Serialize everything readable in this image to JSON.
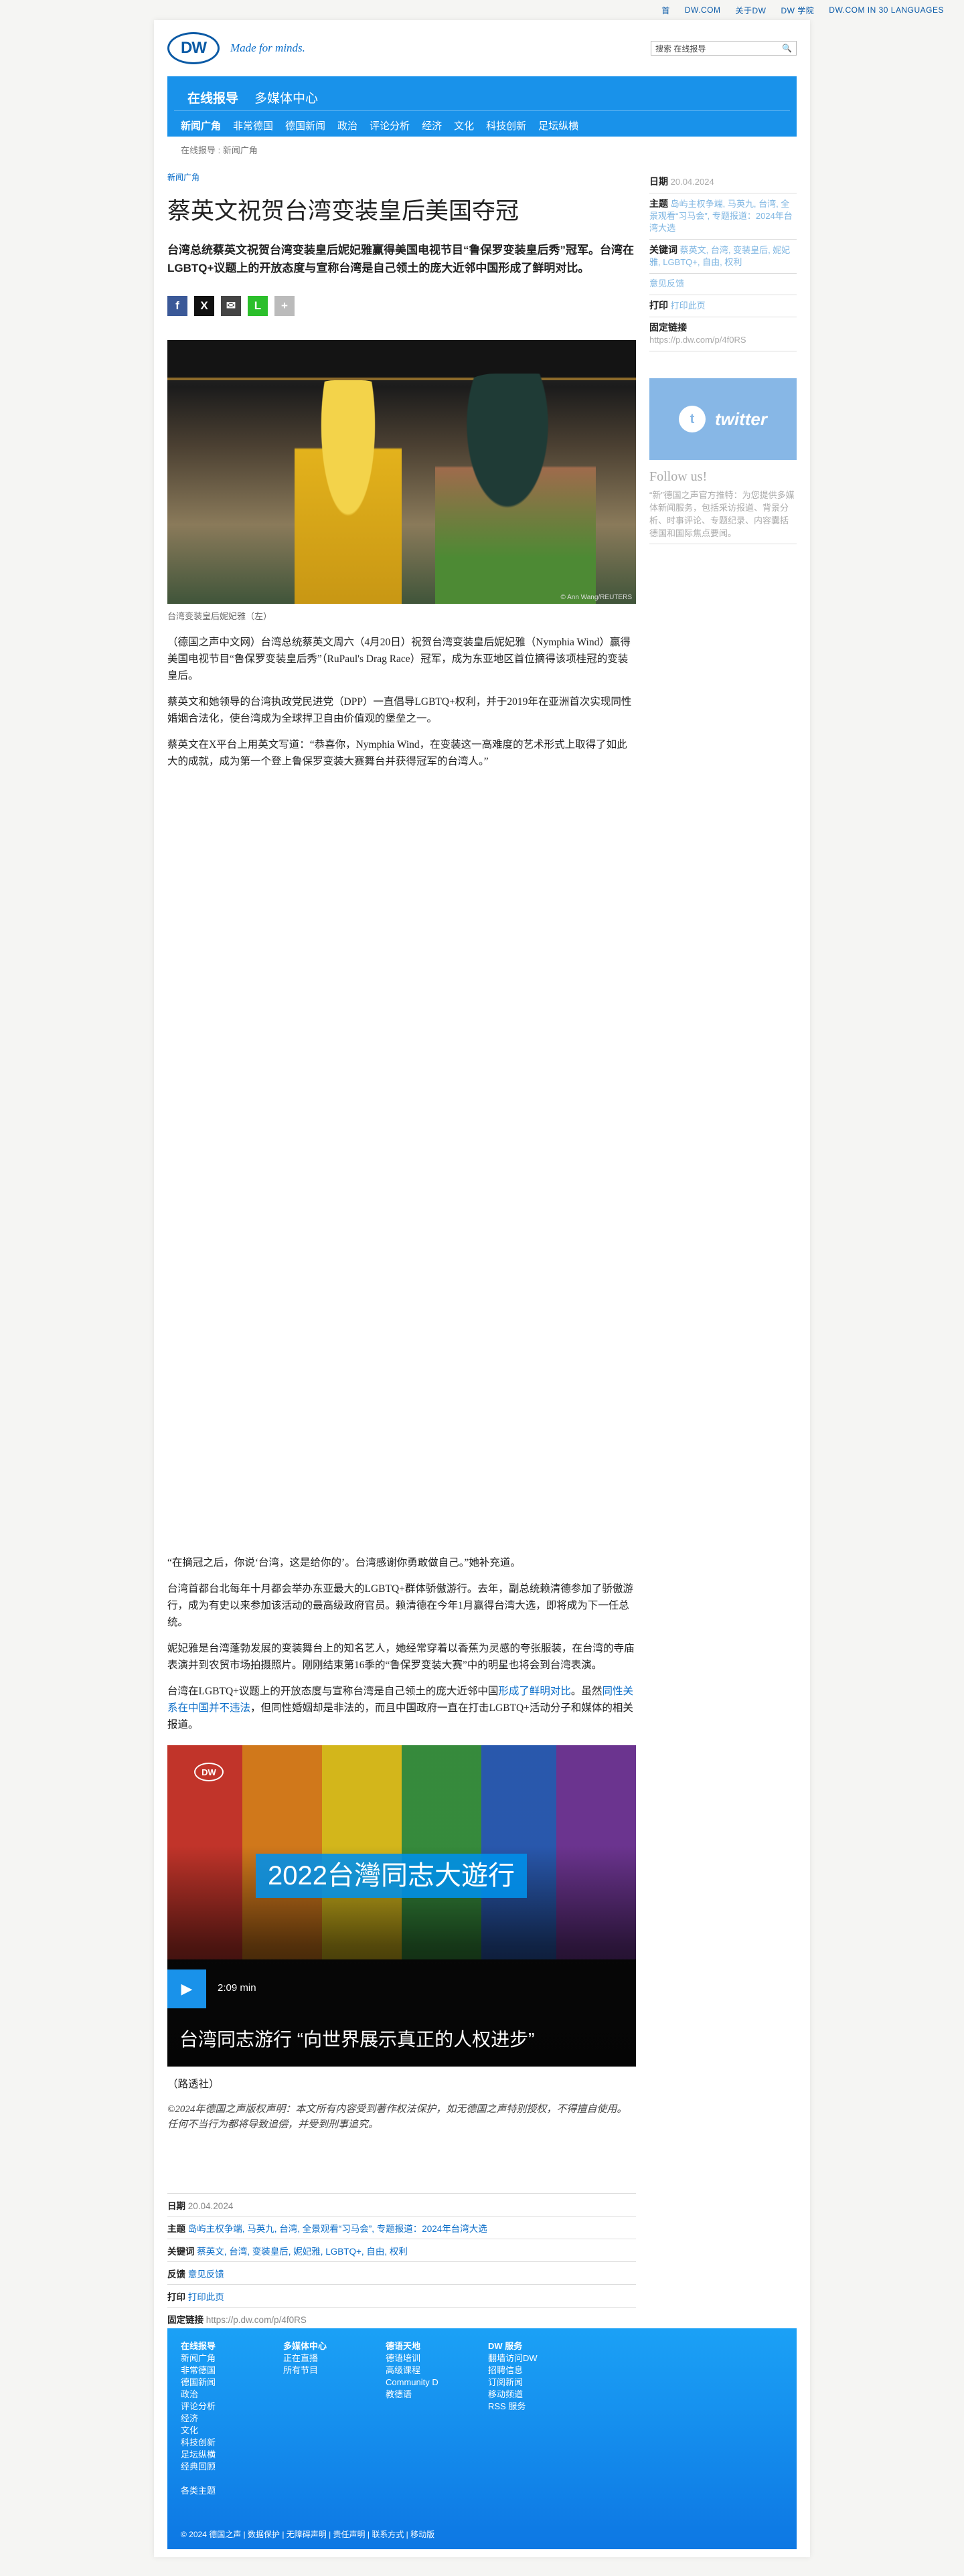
{
  "topbar": {
    "links": [
      "首",
      "DW.COM",
      "关于DW",
      "DW 学院",
      "DW.COM IN 30 LANGUAGES"
    ]
  },
  "header": {
    "logo": "DW",
    "tagline": "Made for minds.",
    "search_placeholder": "搜索 在线报导",
    "search_icon": "magnifier-icon"
  },
  "nav": {
    "top": [
      "在线报导",
      "多媒体中心"
    ],
    "sub": [
      "新闻广角",
      "非常德国",
      "德国新闻",
      "政治",
      "评论分析",
      "经济",
      "文化",
      "科技创新",
      "足坛纵横"
    ]
  },
  "breadcrumb": "在线报导 : 新闻广角",
  "article": {
    "kicker": "新闻广角",
    "title": "蔡英文祝贺台湾变装皇后美国夺冠",
    "lead": "台湾总统蔡英文祝贺台湾变装皇后妮妃雅赢得美国电视节目“鲁保罗变装皇后秀”冠军。台湾在LGBTQ+议题上的开放态度与宣称台湾是自己领土的庞大近邻中国形成了鲜明对比。",
    "share": [
      "f",
      "X",
      "✉",
      "L",
      "+"
    ],
    "image_credit": "© Ann Wang/REUTERS",
    "caption": "台湾变装皇后妮妃雅（左）",
    "paragraphs": [
      "（德国之声中文网）台湾总统蔡英文周六（4月20日）祝贺台湾变装皇后妮妃雅（Nymphia Wind）赢得美国电视节目“鲁保罗变装皇后秀”（RuPaul's Drag Race）冠军，成为东亚地区首位摘得该项桂冠的变装皇后。",
      "蔡英文和她领导的台湾执政党民进党（DPP）一直倡导LGBTQ+权利，并于2019年在亚洲首次实现同性婚姻合法化，使台湾成为全球捍卫自由价值观的堡垒之一。",
      "蔡英文在X平台上用英文写道：“恭喜你，Nymphia Wind，在变装这一高难度的艺术形式上取得了如此大的成就，成为第一个登上鲁保罗变装大赛舞台并获得冠军的台湾人。”",
      "“在摘冠之后，你说‘台湾，这是给你的’。台湾感谢你勇敢做自己。”她补充道。",
      "台湾首都台北每年十月都会举办东亚最大的LGBTQ+群体骄傲游行。去年，副总统赖清德参加了骄傲游行，成为有史以来参加该活动的最高级政府官员。赖清德在今年1月赢得台湾大选，即将成为下一任总统。",
      "妮妃雅是台湾蓬勃发展的变装舞台上的知名艺人，她经常穿着以香蕉为灵感的夸张服装，在台湾的寺庙表演并到农贸市场拍摄照片。刚刚结束第16季的“鲁保罗变装大赛”中的明星也将会到台湾表演。"
    ],
    "p7_before": "台湾在LGBTQ+议题上的开放态度与宣称台湾是自己领土的庞大近邻中国",
    "p7_link1": "形成了鲜明对比",
    "p7_mid": "。虽然",
    "p7_link2": "同性关系在中国并不违法",
    "p7_after": "，但同性婚姻却是非法的，而且中国政府一直在打击LGBTQ+活动分子和媒体的相关报道。",
    "video": {
      "overlay_title": "2022台灣同志大遊行",
      "duration": "2:09 min",
      "title": "台湾同志游行 “向世界展示真正的人权进步”",
      "play_icon": "play-icon"
    },
    "byline": "（路透社）",
    "copyright": "©2024年德国之声版权声明：本文所有内容受到著作权法保护，如无德国之声特别授权，不得擅自使用。任何不当行为都将导致追偿，并受到刑事追究。"
  },
  "meta": {
    "date_label": "日期",
    "date": "20.04.2024",
    "topic_label": "主题",
    "topic": "岛屿主权争端, 马英九, 台湾, 全景观看“习马会”, 专题报道：2024年台湾大选",
    "keywords_label": "关键词",
    "keywords": "蔡英文, 台湾, 变装皇后, 妮妃雅, LGBTQ+, 自由, 权利",
    "feedback_label": "反馈",
    "feedback": "意见反馈",
    "print_label": "打印",
    "print": "打印此页",
    "permalink_label": "固定链接",
    "permalink": "https://p.dw.com/p/4f0RS"
  },
  "sidebar": {
    "twitter_label": "twitter",
    "follow": "Follow us!",
    "follow_text": "“新”德国之声官方推特：为您提供多媒体新闻服务，包括采访报道、背景分析、时事评论、专题纪录、内容囊括德国和国际焦点要闻。"
  },
  "footer": {
    "cols": [
      {
        "head": "在线报导",
        "items": [
          "新闻广角",
          "非常德国",
          "德国新闻",
          "政治",
          "评论分析",
          "经济",
          "文化",
          "科技创新",
          "足坛纵横",
          "经典回顾",
          "",
          "各类主题"
        ]
      },
      {
        "head": "多媒体中心",
        "items": [
          "正在直播",
          "所有节目"
        ]
      },
      {
        "head": "德语天地",
        "items": [
          "德语培训",
          "高级课程",
          "Community D",
          "教德语"
        ]
      },
      {
        "head": "DW 服务",
        "items": [
          "翻墙访问DW",
          "招聘信息",
          "订阅新闻",
          "移动频道",
          "RSS 服务"
        ]
      }
    ],
    "bottom": "© 2024 德国之声 | 数据保护 | 无障碍声明 | 责任声明 | 联系方式 | 移动版"
  }
}
